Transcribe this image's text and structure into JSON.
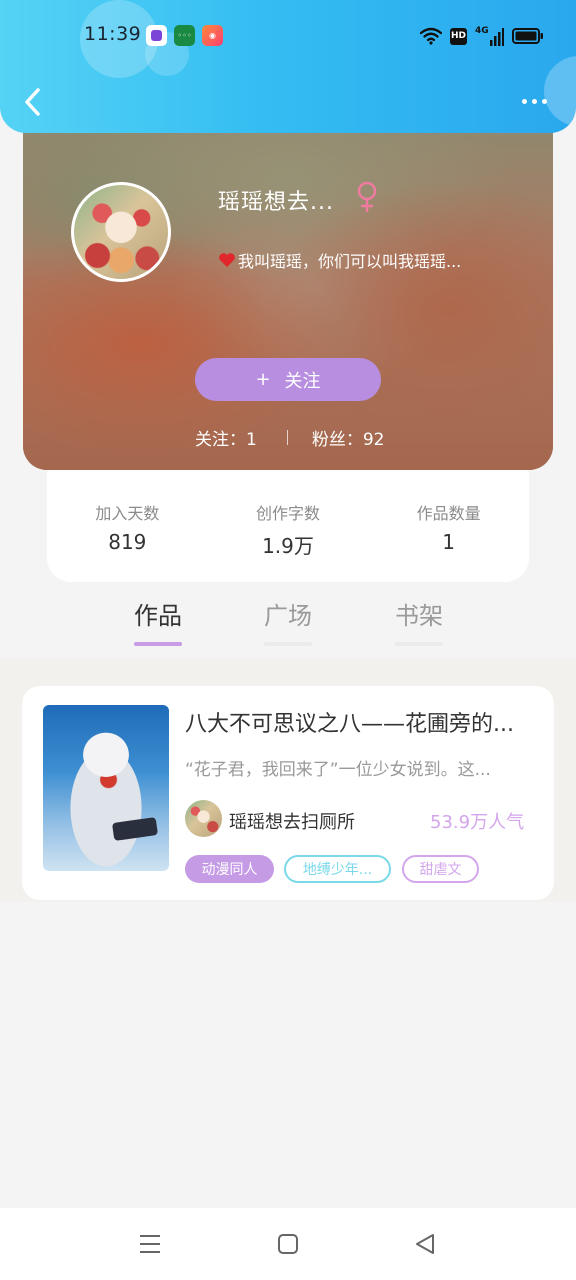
{
  "status_bar": {
    "time": "11:39",
    "app_icons": [
      "purple-app-icon",
      "green-app-icon",
      "orange-app-icon"
    ],
    "hd_label": "HD",
    "network_label": "4G"
  },
  "header": {
    "back_icon": "chevron-left-icon",
    "more_icon": "more-dots-icon",
    "accent_color": "#35bdf2"
  },
  "profile": {
    "username": "瑶瑶想去...",
    "gender_icon": "female-icon",
    "bio_icon": "heart-icon",
    "bio": "我叫瑶瑶，你们可以叫我瑶瑶...",
    "follow_plus": "+",
    "follow_label": "关注",
    "following_text": "关注：1",
    "followers_text": "粉丝：92",
    "follow_button_color": "#b78ee0"
  },
  "stats": [
    {
      "label": "加入天数",
      "value": "819"
    },
    {
      "label": "创作字数",
      "value": "1.9万"
    },
    {
      "label": "作品数量",
      "value": "1"
    }
  ],
  "tabs": [
    {
      "label": "作品",
      "active": true
    },
    {
      "label": "广场",
      "active": false
    },
    {
      "label": "书架",
      "active": false
    }
  ],
  "works": [
    {
      "title": "八大不可思议之八——花圃旁的...",
      "description": "“花子君，我回来了”一位少女说到。这...",
      "author": "瑶瑶想去扫厕所",
      "popularity": "53.9万人气",
      "tags": [
        "动漫同人",
        "地缚少年...",
        "甜虐文"
      ]
    }
  ],
  "system_nav": {
    "menu_icon": "menu-icon",
    "home_icon": "home-square-icon",
    "back_icon": "back-triangle-icon"
  }
}
